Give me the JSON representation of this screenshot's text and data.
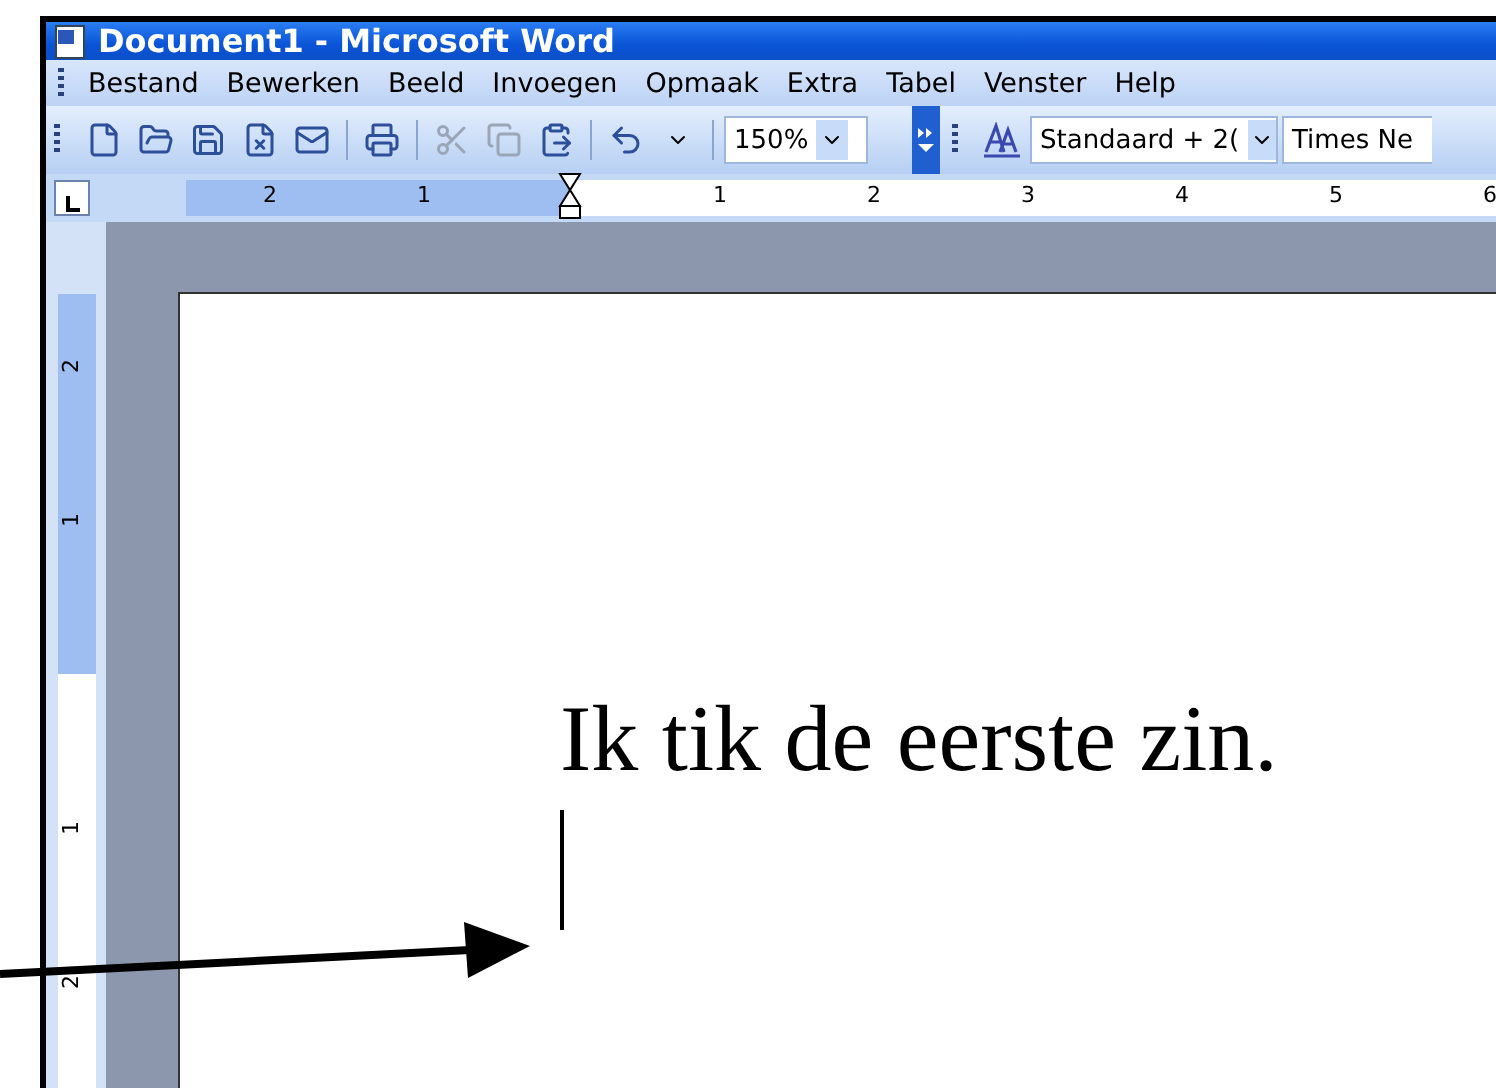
{
  "window": {
    "title": "Document1 - Microsoft Word"
  },
  "menu": [
    {
      "label": "Bestand"
    },
    {
      "label": "Bewerken"
    },
    {
      "label": "Beeld"
    },
    {
      "label": "Invoegen"
    },
    {
      "label": "Opmaak"
    },
    {
      "label": "Extra"
    },
    {
      "label": "Tabel"
    },
    {
      "label": "Venster"
    },
    {
      "label": "Help"
    }
  ],
  "toolbar": [
    {
      "kind": "button",
      "disabled": false
    },
    {
      "kind": "button",
      "disabled": false
    },
    {
      "kind": "button",
      "disabled": false
    },
    {
      "kind": "button",
      "disabled": false
    },
    {
      "kind": "button",
      "disabled": false
    },
    {
      "kind": "separator"
    },
    {
      "kind": "button",
      "disabled": false
    },
    {
      "kind": "separator"
    },
    {
      "kind": "button",
      "disabled": true
    },
    {
      "kind": "button",
      "disabled": true
    },
    {
      "kind": "button",
      "disabled": false
    },
    {
      "kind": "separator"
    },
    {
      "kind": "button",
      "disabled": false
    },
    {
      "kind": "dropdown"
    },
    {
      "kind": "separator"
    },
    {
      "kind": "combo",
      "value": "150%"
    }
  ],
  "format_toolbar": [
    {
      "kind": "button"
    },
    {
      "kind": "combo",
      "value": "Standaard + 2("
    },
    {
      "kind": "combo",
      "value": "Times Ne"
    }
  ],
  "ruler": {
    "before": [
      "2",
      "1"
    ],
    "after": [
      "1",
      "2",
      "3",
      "4",
      "5",
      "6"
    ]
  },
  "vertical_ruler": {
    "before": [
      "2",
      "1"
    ],
    "after": [
      "1",
      "2"
    ]
  },
  "document": {
    "text": "Ik tik de eerste zin."
  }
}
